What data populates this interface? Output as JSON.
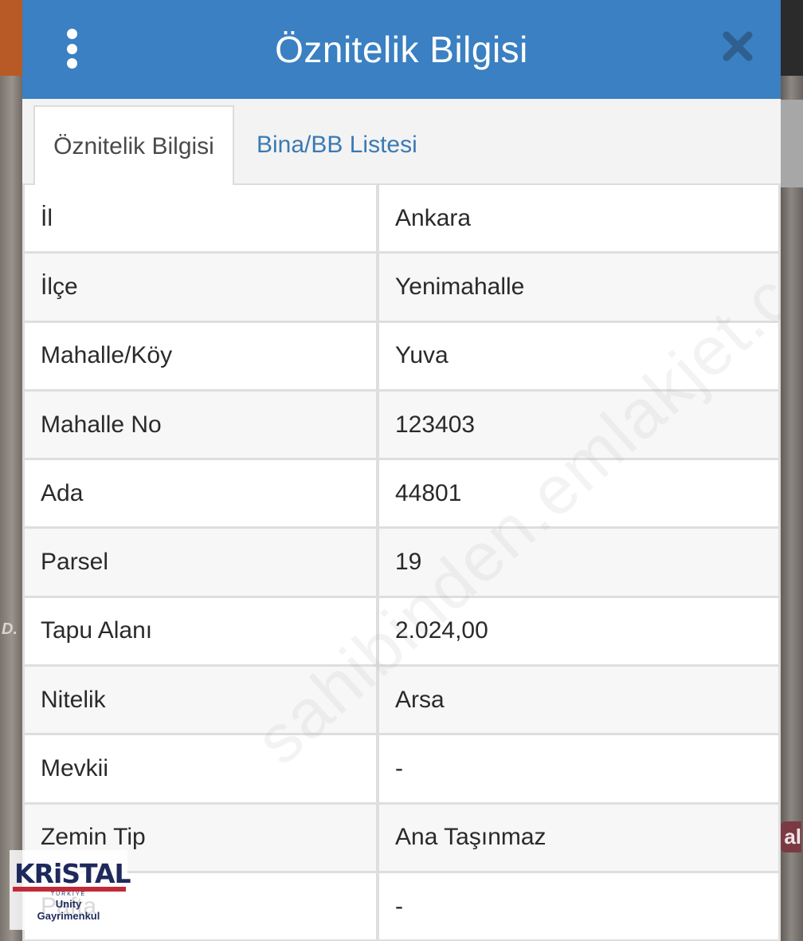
{
  "map": {
    "label_left": "D.",
    "label_right": "al"
  },
  "dialog": {
    "title": "Öznitelik Bilgisi"
  },
  "tabs": [
    {
      "label": "Öznitelik Bilgisi",
      "active": true
    },
    {
      "label": "Bina/BB Listesi",
      "active": false
    }
  ],
  "rows": [
    {
      "key": "İl",
      "value": "Ankara"
    },
    {
      "key": "İlçe",
      "value": "Yenimahalle"
    },
    {
      "key": "Mahalle/Köy",
      "value": "Yuva"
    },
    {
      "key": "Mahalle No",
      "value": "123403"
    },
    {
      "key": "Ada",
      "value": "44801"
    },
    {
      "key": "Parsel",
      "value": "19"
    },
    {
      "key": "Tapu Alanı",
      "value": "2.024,00"
    },
    {
      "key": "Nitelik",
      "value": "Arsa"
    },
    {
      "key": "Mevkii",
      "value": "-"
    },
    {
      "key": "Zemin Tip",
      "value": "Ana Taşınmaz"
    },
    {
      "key": "Pafta",
      "value": "-"
    }
  ],
  "watermark": "sahibinden.emlakjet.com",
  "logo": {
    "brand": "KRiSTAL",
    "country": "TÜRKİYE",
    "line1": "Unity",
    "line2": "Gayrimenkul"
  }
}
